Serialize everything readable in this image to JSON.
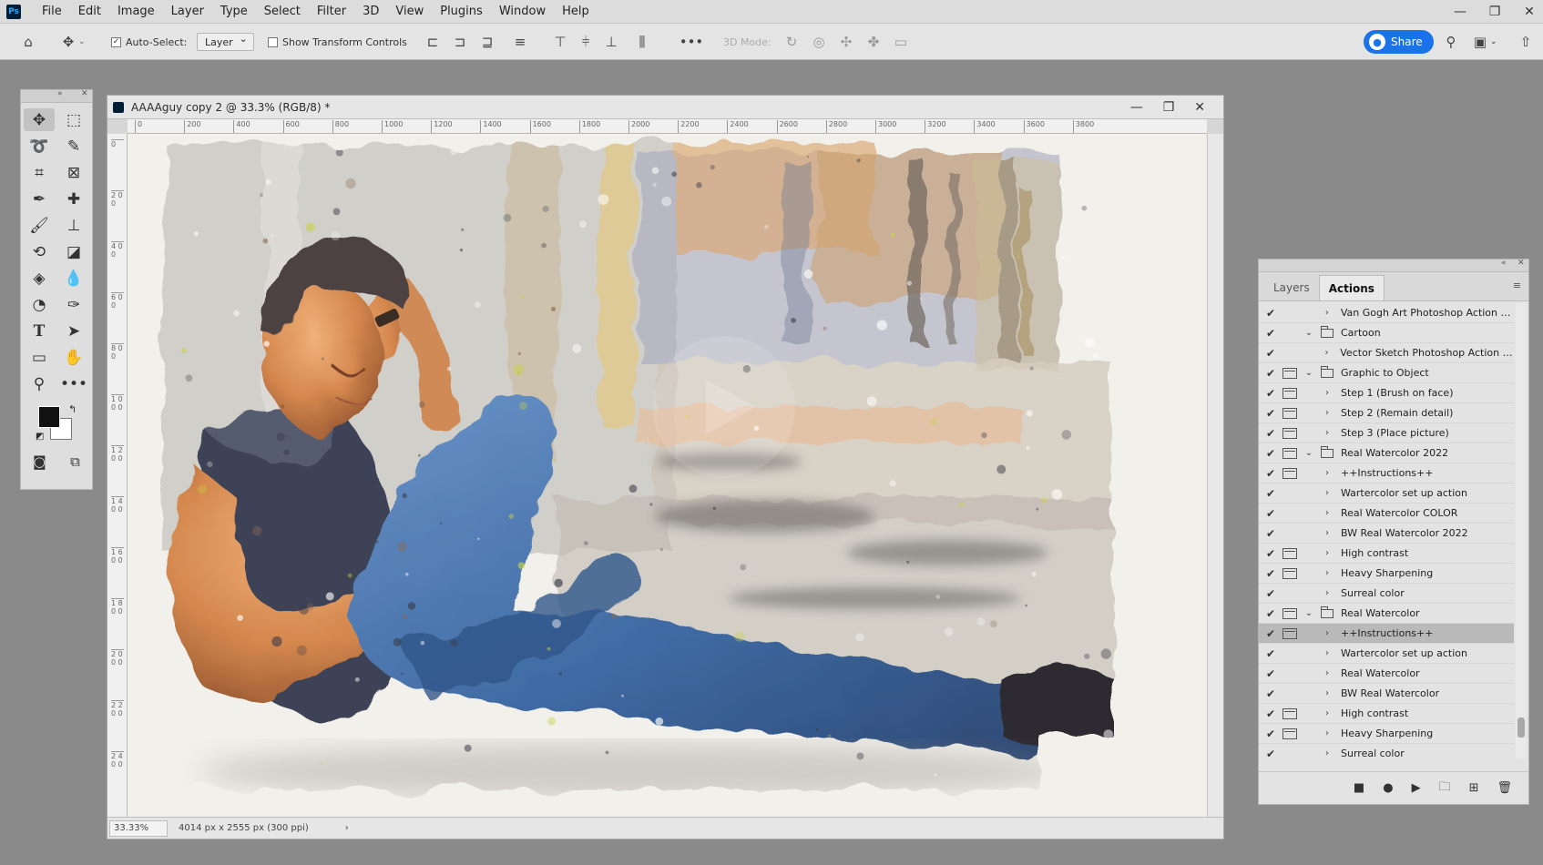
{
  "app": {
    "menu": [
      "File",
      "Edit",
      "Image",
      "Layer",
      "Type",
      "Select",
      "Filter",
      "3D",
      "View",
      "Plugins",
      "Window",
      "Help"
    ],
    "logo": "Ps"
  },
  "options_bar": {
    "auto_select_label": "Auto-Select:",
    "auto_select_value": "Layer",
    "transform_controls_label": "Show Transform Controls",
    "mode_3d_label": "3D Mode:",
    "share_label": "Share"
  },
  "document": {
    "title": "AAAAguy copy 2 @ 33.3% (RGB/8) *",
    "ruler_h": [
      "0",
      "200",
      "400",
      "600",
      "800",
      "1000",
      "1200",
      "1400",
      "1600",
      "1800",
      "2000",
      "2200",
      "2400",
      "2600",
      "2800",
      "3000",
      "3200",
      "3400",
      "3600",
      "3800"
    ],
    "ruler_v": [
      "0",
      "2 0 0",
      "4 0 0",
      "6 0 0",
      "8 0 0",
      "1 0 0 0",
      "1 2 0 0",
      "1 4 0 0",
      "1 6 0 0",
      "1 8 0 0",
      "2 0 0 0",
      "2 2 0 0",
      "2 4 0 0"
    ],
    "zoom": "33.33%",
    "doc_info": "4014 px x 2555 px (300 ppi)"
  },
  "panel": {
    "tabs": [
      "Layers",
      "Actions"
    ],
    "active_tab": "Actions",
    "actions": [
      {
        "type": "item",
        "label": "Van Gogh Art Photoshop Action F...",
        "dialog": false
      },
      {
        "type": "set",
        "label": "Cartoon",
        "dialog": false
      },
      {
        "type": "item",
        "label": "Vector Sketch Photoshop Action (...",
        "dialog": false
      },
      {
        "type": "set",
        "label": "Graphic to Object",
        "dialog": true
      },
      {
        "type": "item",
        "label": "Step 1 (Brush on face)",
        "dialog": true
      },
      {
        "type": "item",
        "label": "Step 2 (Remain detail)",
        "dialog": true
      },
      {
        "type": "item",
        "label": "Step 3 (Place picture)",
        "dialog": true
      },
      {
        "type": "set",
        "label": "Real Watercolor 2022",
        "dialog": true
      },
      {
        "type": "item",
        "label": "++Instructions++",
        "dialog": true
      },
      {
        "type": "item",
        "label": "Wartercolor set up action",
        "dialog": false
      },
      {
        "type": "item",
        "label": "Real Watercolor COLOR",
        "dialog": false
      },
      {
        "type": "item",
        "label": "BW Real Watercolor 2022",
        "dialog": false
      },
      {
        "type": "item",
        "label": "High contrast",
        "dialog": true
      },
      {
        "type": "item",
        "label": "Heavy Sharpening",
        "dialog": true
      },
      {
        "type": "item",
        "label": "Surreal color",
        "dialog": false
      },
      {
        "type": "set",
        "label": "Real Watercolor",
        "dialog": true
      },
      {
        "type": "item",
        "label": "++Instructions++",
        "dialog": true,
        "selected": true
      },
      {
        "type": "item",
        "label": "Wartercolor set up action",
        "dialog": false
      },
      {
        "type": "item",
        "label": "Real Watercolor",
        "dialog": false
      },
      {
        "type": "item",
        "label": "BW Real Watercolor",
        "dialog": false
      },
      {
        "type": "item",
        "label": "High contrast",
        "dialog": true
      },
      {
        "type": "item",
        "label": "Heavy Sharpening",
        "dialog": true
      },
      {
        "type": "item",
        "label": "Surreal color",
        "dialog": false
      }
    ]
  },
  "colors": {
    "share": "#1a73e8",
    "foreground": "#111111",
    "background": "#ffffff"
  }
}
